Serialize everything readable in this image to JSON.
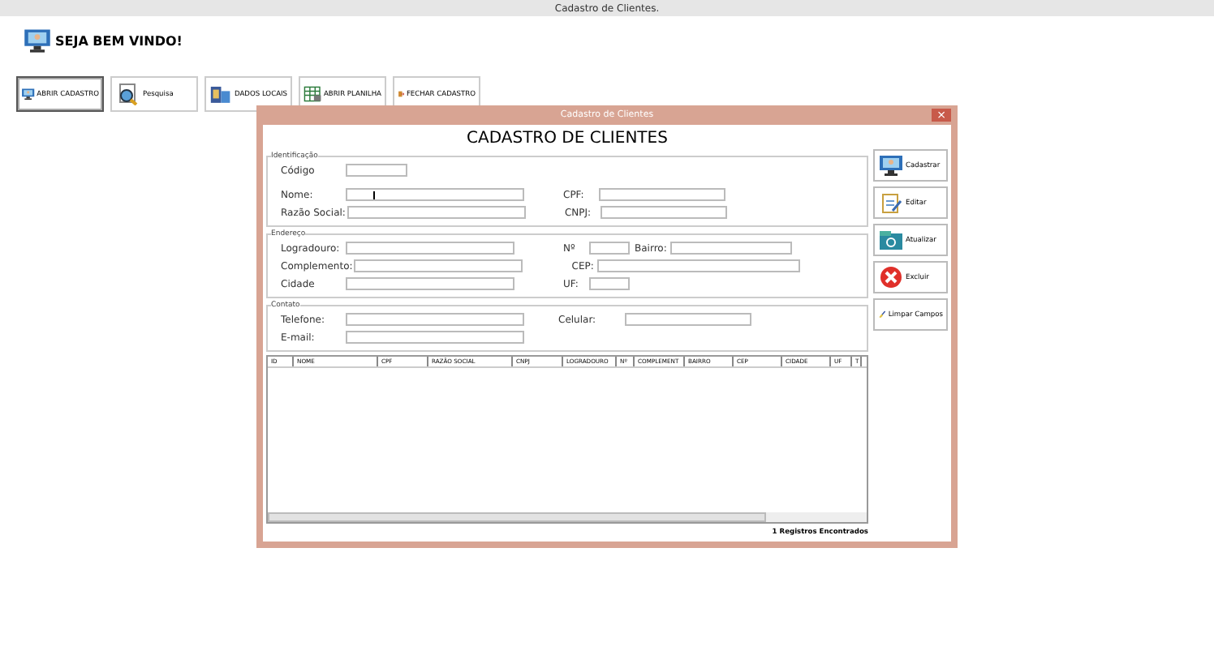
{
  "window": {
    "title": "Cadastro de Clientes."
  },
  "welcome": "SEJA BEM VINDO!",
  "toolbar": [
    {
      "label": "ABRIR CADASTRO",
      "selected": true
    },
    {
      "label": "Pesquisa",
      "selected": false
    },
    {
      "label": "DADOS LOCAIS",
      "selected": false
    },
    {
      "label": "ABRIR PLANILHA",
      "selected": false
    },
    {
      "label": "FECHAR CADASTRO",
      "selected": false
    }
  ],
  "dialog": {
    "title": "Cadastro de Clientes",
    "close": "×",
    "heading": "CADASTRO DE CLIENTES",
    "sections": [
      {
        "legend": "Identificação",
        "rows": [
          [
            {
              "label": "Código"
            }
          ],
          [
            {
              "label": "Nome:",
              "focused": true
            },
            {
              "label": "CPF:"
            }
          ],
          [
            {
              "label": "Razão Social:"
            },
            {
              "label": "CNPJ:"
            }
          ]
        ]
      },
      {
        "legend": "Endereço",
        "rows": [
          [
            {
              "label": "Logradouro:"
            },
            {
              "label": "Nº"
            },
            {
              "label": "Bairro:"
            }
          ],
          [
            {
              "label": "Complemento:"
            },
            {
              "label": "CEP:"
            }
          ],
          [
            {
              "label": "Cidade"
            },
            {
              "label": "UF:"
            }
          ]
        ]
      },
      {
        "legend": "Contato",
        "rows": [
          [
            {
              "label": "Telefone:"
            },
            {
              "label": "Celular:"
            }
          ],
          [
            {
              "label": "E-mail:"
            }
          ]
        ]
      }
    ],
    "table": {
      "columns": [
        "ID",
        "NOME",
        "CPF",
        "RAZÃO SOCIAL",
        "CNPJ",
        "LOGRADOURO",
        "Nº",
        "COMPLEMENT",
        "BAIRRO",
        "CEP",
        "CIDADE",
        "UF",
        "T"
      ]
    },
    "status": "1 Registros Encontrados",
    "actions": [
      {
        "label": "Cadastrar"
      },
      {
        "label": "Editar"
      },
      {
        "label": "Atualizar"
      },
      {
        "label": "Excluir"
      },
      {
        "label": "Limpar Campos"
      }
    ]
  }
}
